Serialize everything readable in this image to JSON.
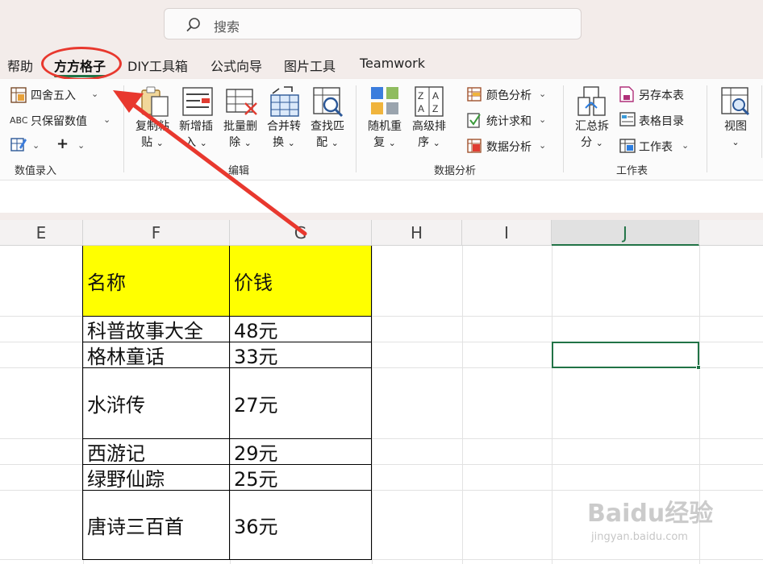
{
  "search": {
    "placeholder": "搜索"
  },
  "tabs": [
    {
      "label": "帮助"
    },
    {
      "label": "方方格子"
    },
    {
      "label": "DIY工具箱"
    },
    {
      "label": "公式向导"
    },
    {
      "label": "图片工具"
    },
    {
      "label": "Teamwork"
    }
  ],
  "ribbon": {
    "numeric_entry": {
      "round": "四舍五入",
      "keep_value": "只保留数值",
      "plus": "+",
      "abc": "ABC",
      "group_label": "数值录入"
    },
    "edit": {
      "copy_paste": [
        "复制粘",
        "贴"
      ],
      "insert_new": [
        "新增插",
        "入"
      ],
      "batch_delete": [
        "批量删",
        "除"
      ],
      "merge_convert": [
        "合并转",
        "换"
      ],
      "find_match": [
        "查找匹",
        "配"
      ],
      "group_label": "编辑"
    },
    "data_analysis": {
      "random_repeat": [
        "随机重",
        "复"
      ],
      "advanced_sort": [
        "高级排",
        "序"
      ],
      "color_analysis": "颜色分析",
      "stat_sum": "统计求和",
      "data_analysis_item": "数据分析",
      "group_label": "数据分析"
    },
    "worksheet": {
      "summarize_split": [
        "汇总拆",
        "分"
      ],
      "save_as": "另存本表",
      "sheet_index": "表格目录",
      "worksheet_item": "工作表",
      "group_label": "工作表"
    },
    "view": {
      "label": "视图"
    }
  },
  "grid": {
    "columns": [
      "E",
      "F",
      "G",
      "H",
      "I",
      "J"
    ],
    "header": {
      "name": "名称",
      "price": "价钱"
    },
    "rows": [
      {
        "name": "科普故事大全",
        "price": "48元"
      },
      {
        "name": "格林童话",
        "price": "33元"
      },
      {
        "name": "水浒传",
        "price": "27元"
      },
      {
        "name": "西游记",
        "price": "29元"
      },
      {
        "name": "绿野仙踪",
        "price": "25元"
      },
      {
        "name": "唐诗三百首",
        "price": "36元"
      }
    ]
  },
  "watermark": {
    "brand": "Baidu经验",
    "url": "jingyan.baidu.com"
  },
  "colors": {
    "accent": "#217346",
    "highlight": "#ffff00",
    "annotation": "#e8382e"
  }
}
